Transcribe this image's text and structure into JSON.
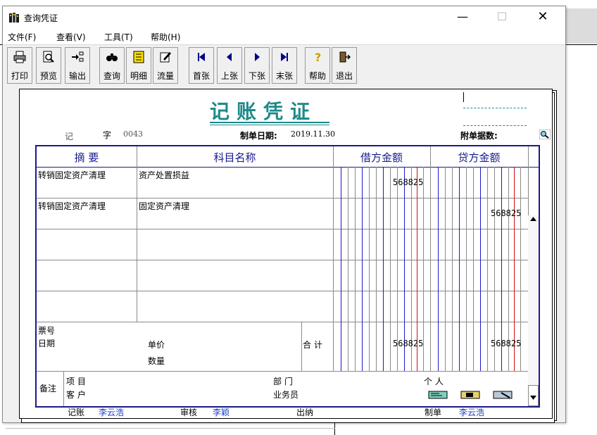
{
  "window": {
    "title": "查询凭证",
    "min": "—",
    "max": "☐",
    "close": "✕"
  },
  "menu": [
    "文件(F)",
    "查看(V)",
    "工具(T)",
    "帮助(H)"
  ],
  "toolbar": {
    "print": "打印",
    "preview": "预览",
    "export": "输出",
    "query": "查询",
    "detail": "明细",
    "flow": "流量",
    "first": "首张",
    "prev": "上张",
    "next": "下张",
    "last": "末张",
    "help": "帮助",
    "exit": "退出"
  },
  "voucher": {
    "title": "记账凭证",
    "type": "记",
    "zi": "字",
    "number": "0043",
    "date_label": "制单日期:",
    "date": "2019.11.30",
    "attach_label": "附单据数:",
    "headers": {
      "summary": "摘 要",
      "account": "科目名称",
      "debit": "借方金额",
      "credit": "贷方金额"
    },
    "entries": [
      {
        "summary": "转销固定资产清理",
        "account": "资产处置损益",
        "debit": "568825",
        "credit": ""
      },
      {
        "summary": "转销固定资产清理",
        "account": "固定资产清理",
        "debit": "",
        "credit": "568825"
      }
    ],
    "footer": {
      "ticket_no": "票号",
      "date": "日期",
      "unit_price": "单价",
      "quantity": "数量",
      "total_label": "合 计",
      "total_debit": "568825",
      "total_credit": "568825"
    },
    "notes": {
      "label": "备注",
      "project": "项  目",
      "customer": "客  户",
      "dept": "部  门",
      "salesman": "业务员",
      "person": "个  人"
    },
    "signatures": {
      "bookkeeper_label": "记账",
      "bookkeeper": "李云浩",
      "auditor_label": "审核",
      "auditor": "李颖",
      "cashier_label": "出纳",
      "maker_label": "制单",
      "maker": "李云浩"
    }
  },
  "colors": {
    "accent": "#1f8a8a",
    "grid": "#1a1a8c",
    "amount_blue": "#1a1acc",
    "amount_red": "#d01010",
    "name_blue": "#1a3fc7"
  }
}
